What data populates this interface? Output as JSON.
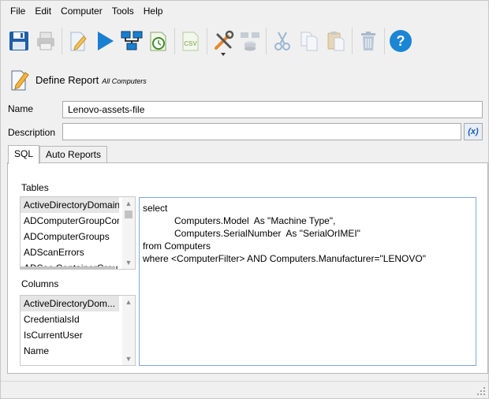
{
  "menu": [
    "File",
    "Edit",
    "Computer",
    "Tools",
    "Help"
  ],
  "toolbar": {
    "groups": [
      [
        "save-icon",
        "print-icon"
      ],
      [
        "edit-icon",
        "run-icon",
        "network-icon",
        "schedule-icon"
      ],
      [
        "csv-icon"
      ],
      [
        "tools-icon",
        "database-icon"
      ],
      [
        "cut-icon",
        "copy-icon",
        "paste-icon"
      ],
      [
        "delete-icon"
      ],
      [
        "help-icon"
      ]
    ]
  },
  "header": {
    "title": "Define Report",
    "subtitle": "All Computers"
  },
  "form": {
    "name_label": "Name",
    "name_value": "Lenovo-assets-file",
    "description_label": "Description",
    "description_value": "",
    "variable_button": "(x)"
  },
  "tabs": [
    {
      "label": "SQL",
      "active": true
    },
    {
      "label": "Auto Reports",
      "active": false
    }
  ],
  "tables": {
    "label": "Tables",
    "items": [
      "ActiveDirectoryDomain",
      "ADComputerGroupCon",
      "ADComputerGroups",
      "ADScanErrors",
      "ADSec ContainerGrou"
    ],
    "selected": 0
  },
  "columns": {
    "label": "Columns",
    "items": [
      "ActiveDirectoryDom...",
      "CredentialsId",
      "IsCurrentUser",
      "Name"
    ],
    "selected": 0
  },
  "sql": {
    "lines": [
      "select",
      "            Computers.Model  As \"Machine Type\",",
      "            Computers.SerialNumber  As \"SerialOrIMEI\"",
      "from Computers",
      "where <ComputerFilter> AND Computers.Manufacturer=\"LENOVO\""
    ]
  },
  "colors": {
    "accent_blue": "#1a7fd0",
    "save_blue": "#1f5fa8",
    "help_blue": "#1a86d4",
    "editor_border": "#7ea6d8"
  }
}
